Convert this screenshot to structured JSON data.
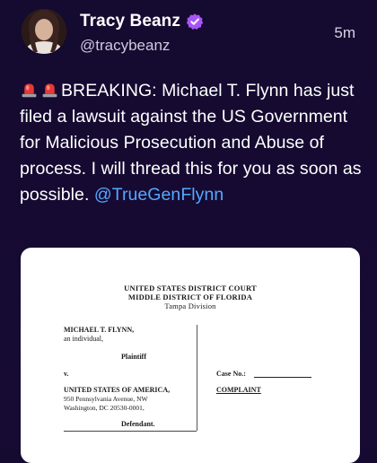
{
  "tweet": {
    "display_name": "Tracy Beanz",
    "handle": "@tracybeanz",
    "timestamp": "5m",
    "verified": true,
    "text_main": "BREAKING: Michael T. Flynn has just filed a lawsuit against the US Government for Malicious Prosecution and Abuse of process. I will thread this for you as soon as possible. ",
    "mention": "@TrueGenFlynn",
    "icons": [
      "police-light-icon",
      "police-light-icon"
    ]
  },
  "document": {
    "court_line1": "UNITED STATES DISTRICT COURT",
    "court_line2": "MIDDLE DISTRICT OF FLORIDA",
    "court_line3": "Tampa Division",
    "plaintiff_name": "MICHAEL T. FLYNN,",
    "plaintiff_desc": "an individual,",
    "plaintiff_role": "Plaintiff",
    "versus": "v.",
    "defendant_name": "UNITED STATES OF AMERICA,",
    "defendant_addr1": "950 Pennsylvania Avenue, NW",
    "defendant_addr2": "Washington, DC 20530-0001,",
    "defendant_role": "Defendant.",
    "case_label": "Case No.:",
    "complaint_label": "COMPLAINT"
  },
  "colors": {
    "background": "#160a32",
    "mention": "#55a7ff",
    "verified_badge": "#a855f7"
  }
}
